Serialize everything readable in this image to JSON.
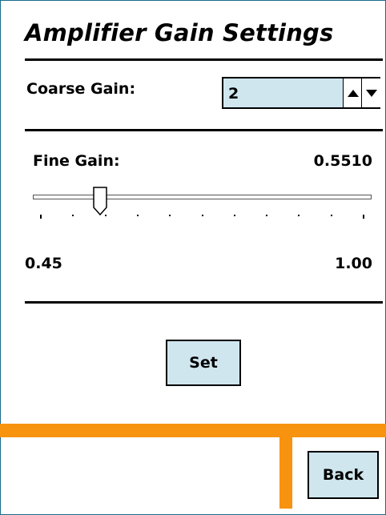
{
  "title": "Amplifier Gain Settings",
  "coarse_gain": {
    "label": "Coarse Gain:",
    "value": "2"
  },
  "fine_gain": {
    "label": "Fine Gain:",
    "value": "0.5510",
    "min_label": "0.45",
    "max_label": "1.00",
    "min": 0.45,
    "max": 1.0,
    "current": 0.551,
    "tick_count": 11
  },
  "buttons": {
    "set": "Set",
    "back": "Back"
  },
  "colors": {
    "accent": "#f7930f",
    "control_fill": "#cfe6ee"
  },
  "icons": {
    "up": "triangle-up-icon",
    "down": "triangle-down-icon",
    "thumb": "slider-thumb-icon"
  }
}
